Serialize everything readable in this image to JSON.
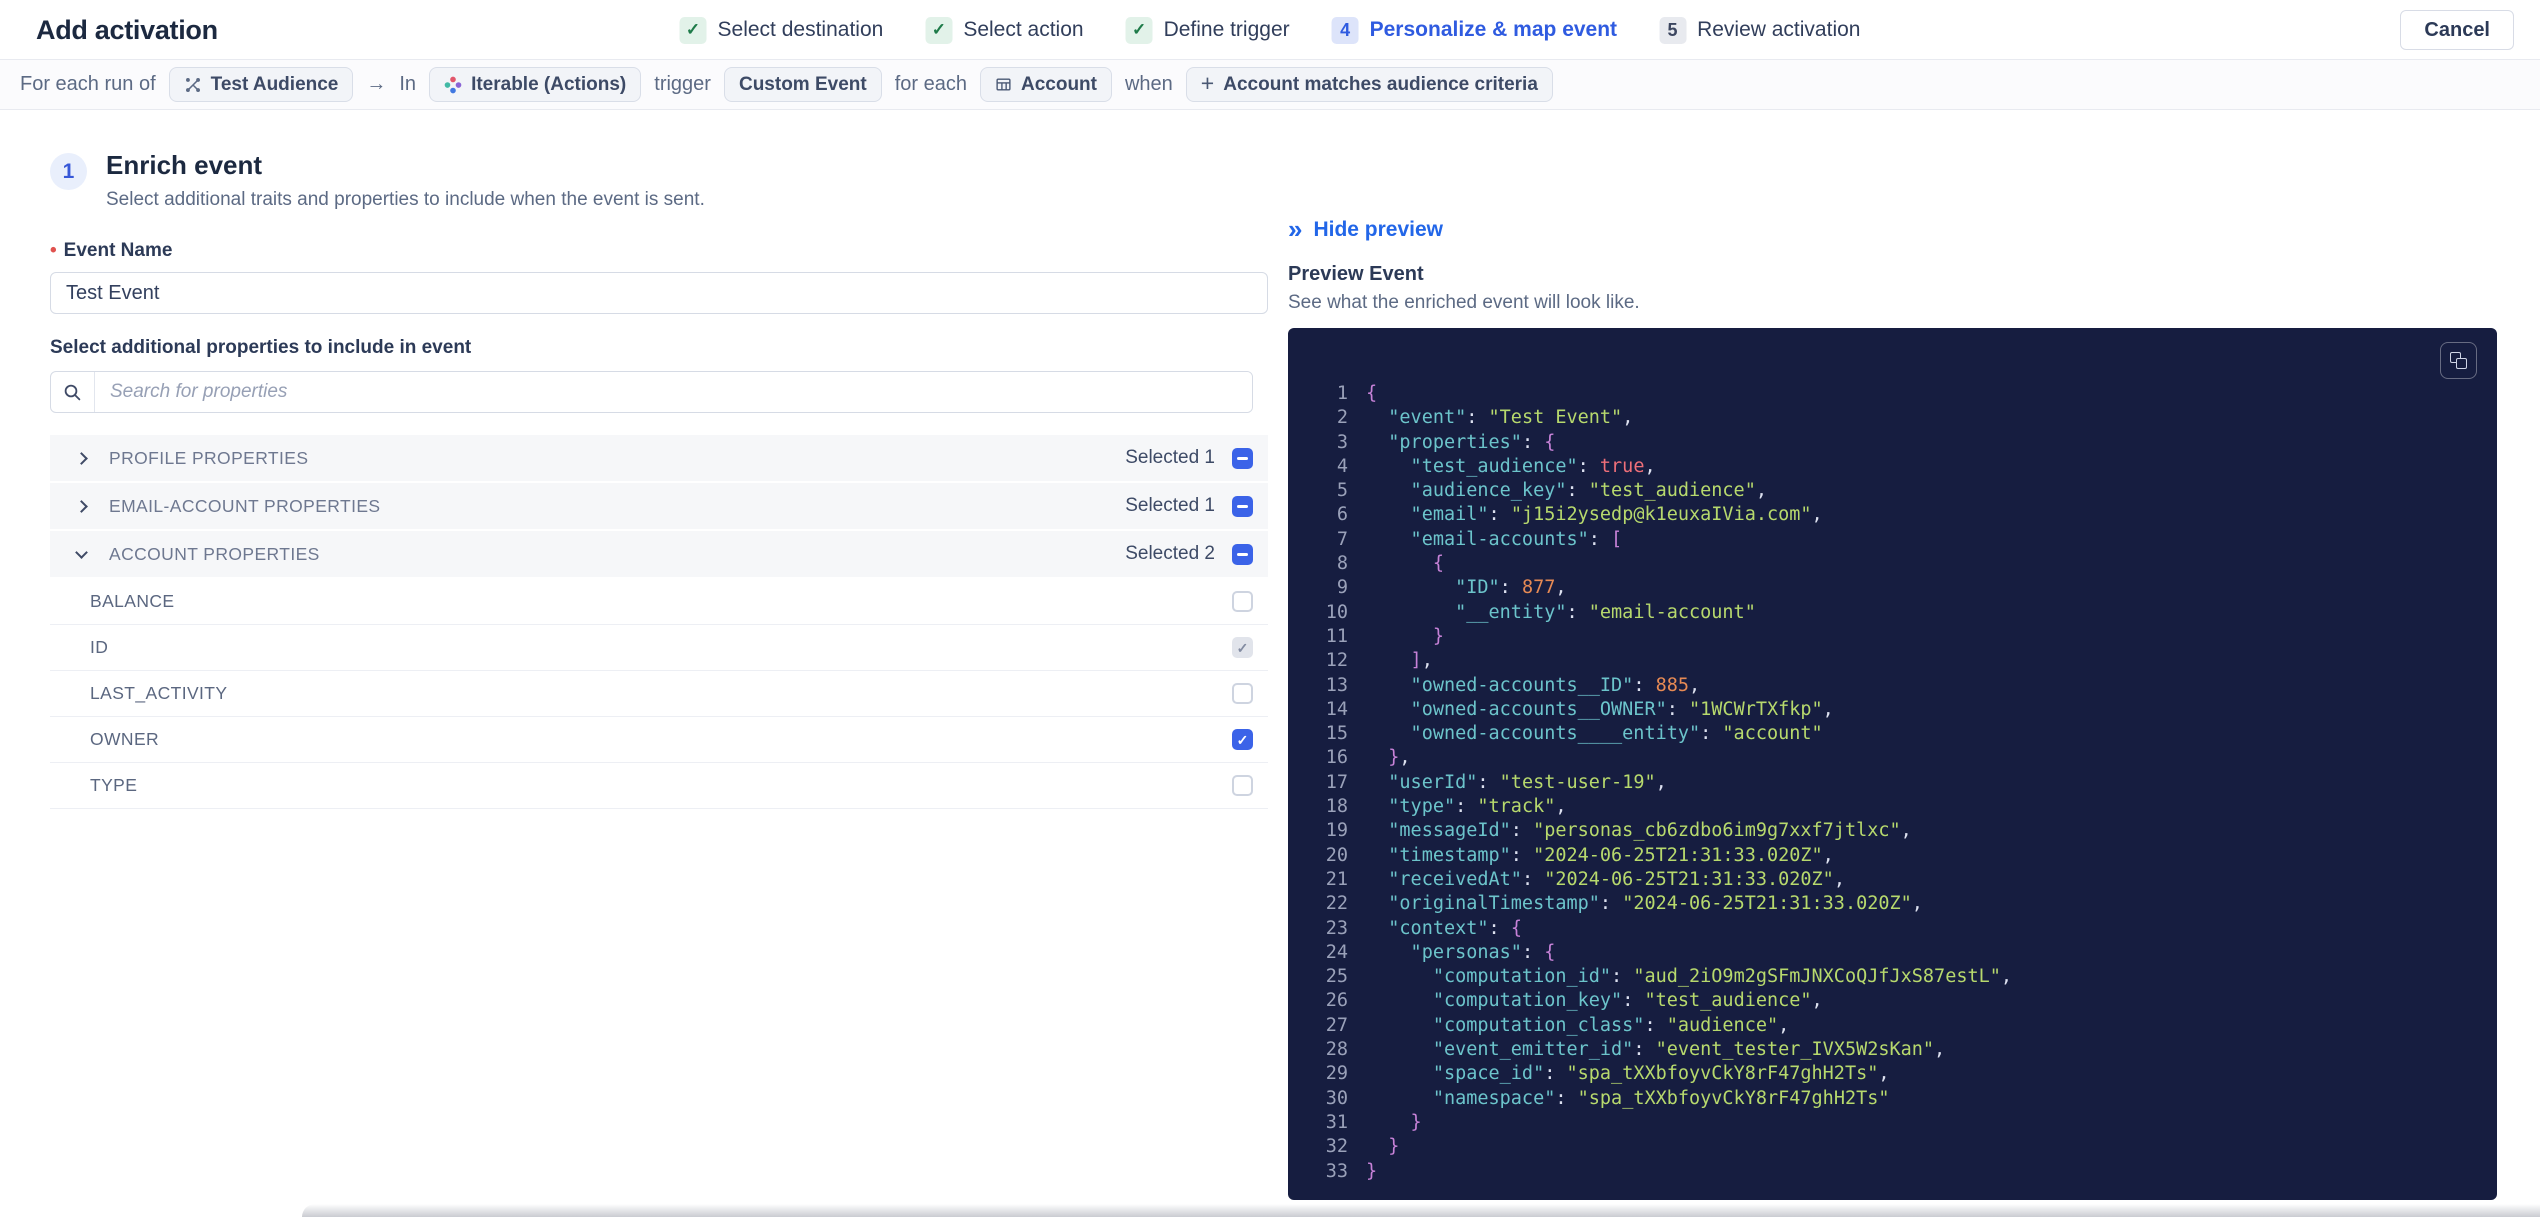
{
  "header": {
    "title": "Add activation",
    "cancel_label": "Cancel",
    "steps": [
      {
        "label": "Select destination",
        "state": "done"
      },
      {
        "label": "Select action",
        "state": "done"
      },
      {
        "label": "Define trigger",
        "state": "done"
      },
      {
        "label": "Personalize & map event",
        "state": "active",
        "number": "4"
      },
      {
        "label": "Review activation",
        "state": "upcoming",
        "number": "5"
      }
    ]
  },
  "context_bar": {
    "tokens": [
      {
        "type": "text",
        "label": "For each run of"
      },
      {
        "type": "chip",
        "icon": "audience-icon",
        "label": "Test Audience"
      },
      {
        "type": "text",
        "label": "→",
        "name": "arrow-right-icon"
      },
      {
        "type": "text",
        "label": "In"
      },
      {
        "type": "chip",
        "icon": "iterable-logo",
        "label": "Iterable (Actions)"
      },
      {
        "type": "text",
        "label": "trigger"
      },
      {
        "type": "chip",
        "label": "Custom Event"
      },
      {
        "type": "text",
        "label": "for each"
      },
      {
        "type": "chip",
        "icon": "table-icon",
        "label": "Account"
      },
      {
        "type": "text",
        "label": "when"
      },
      {
        "type": "chip",
        "icon": "plus-icon",
        "label": "Account matches audience criteria"
      }
    ]
  },
  "enrich": {
    "step_number": "1",
    "title": "Enrich event",
    "subtitle": "Select additional traits and properties to include when the event is sent.",
    "required_marker": "•",
    "event_name_label": "Event Name",
    "event_name_value": "Test Event",
    "properties_label": "Select additional properties to include in event",
    "search_placeholder": "Search for properties",
    "groups": [
      {
        "label": "PROFILE PROPERTIES",
        "selected_text": "Selected 1",
        "expanded": false
      },
      {
        "label": "EMAIL-ACCOUNT PROPERTIES",
        "selected_text": "Selected 1",
        "expanded": false
      },
      {
        "label": "ACCOUNT PROPERTIES",
        "selected_text": "Selected 2",
        "expanded": true,
        "properties": [
          {
            "label": "BALANCE",
            "checked": "none"
          },
          {
            "label": "ID",
            "checked": "disabled"
          },
          {
            "label": "LAST_ACTIVITY",
            "checked": "none"
          },
          {
            "label": "OWNER",
            "checked": "checked"
          },
          {
            "label": "TYPE",
            "checked": "none"
          }
        ]
      }
    ]
  },
  "preview": {
    "hide_icon": "»",
    "hide_label": "Hide preview",
    "title": "Preview Event",
    "subtitle": "See what the enriched event will look like.",
    "code_lines": [
      {
        "n": "1",
        "segs": [
          [
            "b",
            "{"
          ]
        ]
      },
      {
        "n": "2",
        "segs": [
          [
            "k",
            "  \"event\""
          ],
          [
            "p",
            ": "
          ],
          [
            "s",
            "\"Test Event\""
          ],
          [
            "p",
            ","
          ]
        ]
      },
      {
        "n": "3",
        "segs": [
          [
            "k",
            "  \"properties\""
          ],
          [
            "p",
            ": "
          ],
          [
            "b",
            "{"
          ]
        ]
      },
      {
        "n": "4",
        "segs": [
          [
            "k",
            "    \"test_audience\""
          ],
          [
            "p",
            ": "
          ],
          [
            "t",
            "true"
          ],
          [
            "p",
            ","
          ]
        ]
      },
      {
        "n": "5",
        "segs": [
          [
            "k",
            "    \"audience_key\""
          ],
          [
            "p",
            ": "
          ],
          [
            "s",
            "\"test_audience\""
          ],
          [
            "p",
            ","
          ]
        ]
      },
      {
        "n": "6",
        "segs": [
          [
            "k",
            "    \"email\""
          ],
          [
            "p",
            ": "
          ],
          [
            "s",
            "\"j15i2ysedp@k1euxaIVia.com\""
          ],
          [
            "p",
            ","
          ]
        ]
      },
      {
        "n": "7",
        "segs": [
          [
            "k",
            "    \"email-accounts\""
          ],
          [
            "p",
            ": "
          ],
          [
            "b",
            "["
          ]
        ]
      },
      {
        "n": "8",
        "segs": [
          [
            "b",
            "      {"
          ]
        ]
      },
      {
        "n": "9",
        "segs": [
          [
            "k",
            "        \"ID\""
          ],
          [
            "p",
            ": "
          ],
          [
            "n",
            "877"
          ],
          [
            "p",
            ","
          ]
        ]
      },
      {
        "n": "10",
        "segs": [
          [
            "k",
            "        \"__entity\""
          ],
          [
            "p",
            ": "
          ],
          [
            "s",
            "\"email-account\""
          ]
        ]
      },
      {
        "n": "11",
        "segs": [
          [
            "b",
            "      }"
          ]
        ]
      },
      {
        "n": "12",
        "segs": [
          [
            "b",
            "    ]"
          ],
          [
            "p",
            ","
          ]
        ]
      },
      {
        "n": "13",
        "segs": [
          [
            "k",
            "    \"owned-accounts__ID\""
          ],
          [
            "p",
            ": "
          ],
          [
            "n",
            "885"
          ],
          [
            "p",
            ","
          ]
        ]
      },
      {
        "n": "14",
        "segs": [
          [
            "k",
            "    \"owned-accounts__OWNER\""
          ],
          [
            "p",
            ": "
          ],
          [
            "s",
            "\"1WCWrTXfkp\""
          ],
          [
            "p",
            ","
          ]
        ]
      },
      {
        "n": "15",
        "segs": [
          [
            "k",
            "    \"owned-accounts____entity\""
          ],
          [
            "p",
            ": "
          ],
          [
            "s",
            "\"account\""
          ]
        ]
      },
      {
        "n": "16",
        "segs": [
          [
            "b",
            "  }"
          ],
          [
            "p",
            ","
          ]
        ]
      },
      {
        "n": "17",
        "segs": [
          [
            "k",
            "  \"userId\""
          ],
          [
            "p",
            ": "
          ],
          [
            "s",
            "\"test-user-19\""
          ],
          [
            "p",
            ","
          ]
        ]
      },
      {
        "n": "18",
        "segs": [
          [
            "k",
            "  \"type\""
          ],
          [
            "p",
            ": "
          ],
          [
            "s",
            "\"track\""
          ],
          [
            "p",
            ","
          ]
        ]
      },
      {
        "n": "19",
        "segs": [
          [
            "k",
            "  \"messageId\""
          ],
          [
            "p",
            ": "
          ],
          [
            "s",
            "\"personas_cb6zdbo6im9g7xxf7jtlxc\""
          ],
          [
            "p",
            ","
          ]
        ]
      },
      {
        "n": "20",
        "segs": [
          [
            "k",
            "  \"timestamp\""
          ],
          [
            "p",
            ": "
          ],
          [
            "s",
            "\"2024-06-25T21:31:33.020Z\""
          ],
          [
            "p",
            ","
          ]
        ]
      },
      {
        "n": "21",
        "segs": [
          [
            "k",
            "  \"receivedAt\""
          ],
          [
            "p",
            ": "
          ],
          [
            "s",
            "\"2024-06-25T21:31:33.020Z\""
          ],
          [
            "p",
            ","
          ]
        ]
      },
      {
        "n": "22",
        "segs": [
          [
            "k",
            "  \"originalTimestamp\""
          ],
          [
            "p",
            ": "
          ],
          [
            "s",
            "\"2024-06-25T21:31:33.020Z\""
          ],
          [
            "p",
            ","
          ]
        ]
      },
      {
        "n": "23",
        "segs": [
          [
            "k",
            "  \"context\""
          ],
          [
            "p",
            ": "
          ],
          [
            "b",
            "{"
          ]
        ]
      },
      {
        "n": "24",
        "segs": [
          [
            "k",
            "    \"personas\""
          ],
          [
            "p",
            ": "
          ],
          [
            "b",
            "{"
          ]
        ]
      },
      {
        "n": "25",
        "segs": [
          [
            "k",
            "      \"computation_id\""
          ],
          [
            "p",
            ": "
          ],
          [
            "s",
            "\"aud_2iO9m2gSFmJNXCoQJfJxS87estL\""
          ],
          [
            "p",
            ","
          ]
        ]
      },
      {
        "n": "26",
        "segs": [
          [
            "k",
            "      \"computation_key\""
          ],
          [
            "p",
            ": "
          ],
          [
            "s",
            "\"test_audience\""
          ],
          [
            "p",
            ","
          ]
        ]
      },
      {
        "n": "27",
        "segs": [
          [
            "k",
            "      \"computation_class\""
          ],
          [
            "p",
            ": "
          ],
          [
            "s",
            "\"audience\""
          ],
          [
            "p",
            ","
          ]
        ]
      },
      {
        "n": "28",
        "segs": [
          [
            "k",
            "      \"event_emitter_id\""
          ],
          [
            "p",
            ": "
          ],
          [
            "s",
            "\"event_tester_IVX5W2sKan\""
          ],
          [
            "p",
            ","
          ]
        ]
      },
      {
        "n": "29",
        "segs": [
          [
            "k",
            "      \"space_id\""
          ],
          [
            "p",
            ": "
          ],
          [
            "s",
            "\"spa_tXXbfoyvCkY8rF47ghH2Ts\""
          ],
          [
            "p",
            ","
          ]
        ]
      },
      {
        "n": "30",
        "segs": [
          [
            "k",
            "      \"namespace\""
          ],
          [
            "p",
            ": "
          ],
          [
            "s",
            "\"spa_tXXbfoyvCkY8rF47ghH2Ts\""
          ]
        ]
      },
      {
        "n": "31",
        "segs": [
          [
            "b",
            "    }"
          ]
        ]
      },
      {
        "n": "32",
        "segs": [
          [
            "b",
            "  }"
          ]
        ]
      },
      {
        "n": "33",
        "segs": [
          [
            "b",
            "}"
          ]
        ]
      }
    ]
  },
  "icons": {
    "check_glyph": "✓",
    "search": "search-icon",
    "copy": "copy-icon",
    "collapse": "chevron-right-icon",
    "expand": "chevron-down-icon"
  },
  "colors": {
    "accent": "#2266e8",
    "checkbox_blue": "#3b63e8",
    "step_done_green": "#1e7b49",
    "code_bg": "#161d40",
    "tok_key": "#6cc4cb",
    "tok_str": "#b7d96d",
    "tok_num": "#e78a54",
    "tok_bool": "#ee6f79",
    "tok_brace": "#c782d8",
    "tok_punct": "#dde1f0",
    "line_number": "#9aa1b9",
    "iterable_dots": [
      "#e2566b",
      "#8a64d6",
      "#4178e1",
      "#41b9a5"
    ]
  }
}
